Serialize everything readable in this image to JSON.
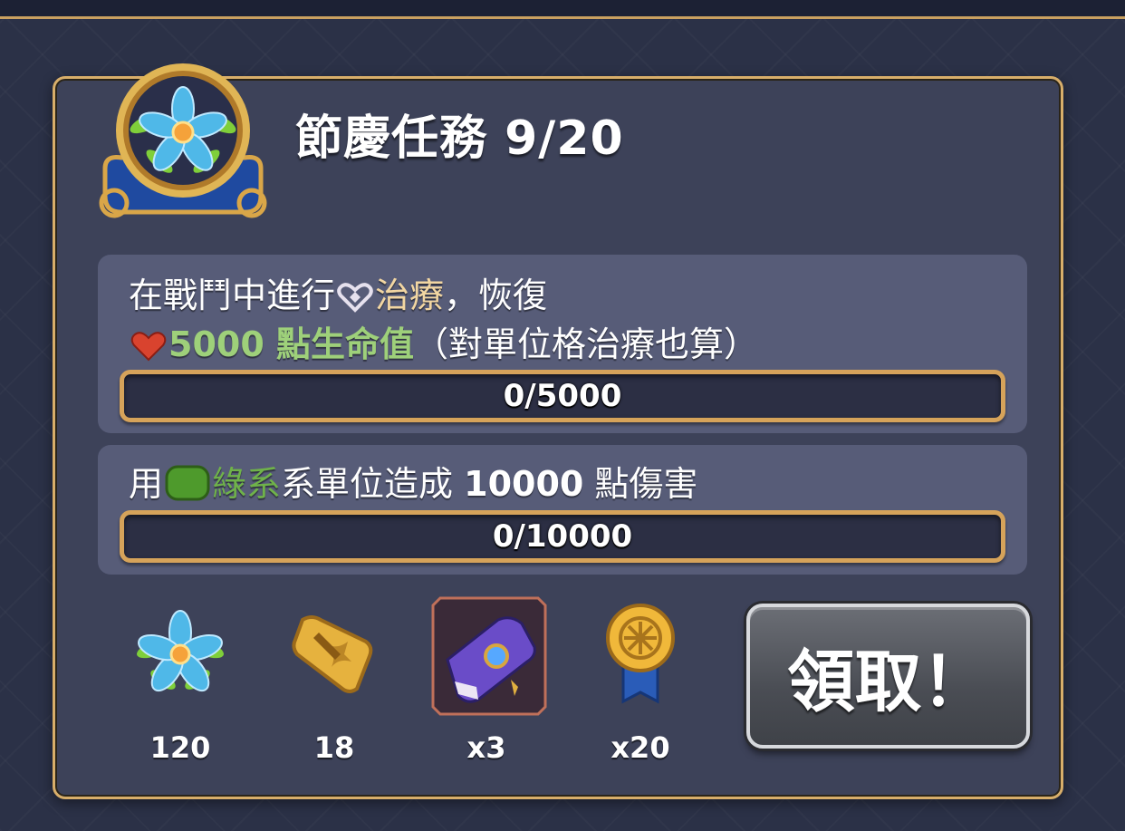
{
  "quest": {
    "title": "節慶任務 9/20",
    "icon": "blue-flower-icon"
  },
  "tasks": [
    {
      "line1_pre": "在戰鬥中進行",
      "line1_icon": "heal-icon",
      "line1_highlight": "治療",
      "line1_post": "，恢復",
      "line2_icon": "heart-icon",
      "line2_highlight": "5000 點生命值",
      "line2_post": "（對單位格治療也算）",
      "progress_text": "0/5000",
      "progress": 0
    },
    {
      "line1_pre": "用",
      "line1_icon": "nature-element-icon",
      "line1_highlight": "綠系",
      "line1_post": "系單位造成 ",
      "line1_bold": "10000",
      "line1_tail": " 點傷害",
      "progress_text": "0/10000",
      "progress": 0
    }
  ],
  "rewards": [
    {
      "icon": "blue-flower-icon",
      "count": "120"
    },
    {
      "icon": "gold-sword-ticket-icon",
      "count": "18"
    },
    {
      "icon": "purple-tome-icon",
      "count": "x3"
    },
    {
      "icon": "gold-medal-icon",
      "count": "x20"
    }
  ],
  "claim_button": {
    "label": "領取！"
  },
  "colors": {
    "panel_border": "#d8ae6a",
    "progress_border": "#d6a35a",
    "heal_highlight": "#f2d6a2",
    "green_highlight": "#9ed07a"
  }
}
